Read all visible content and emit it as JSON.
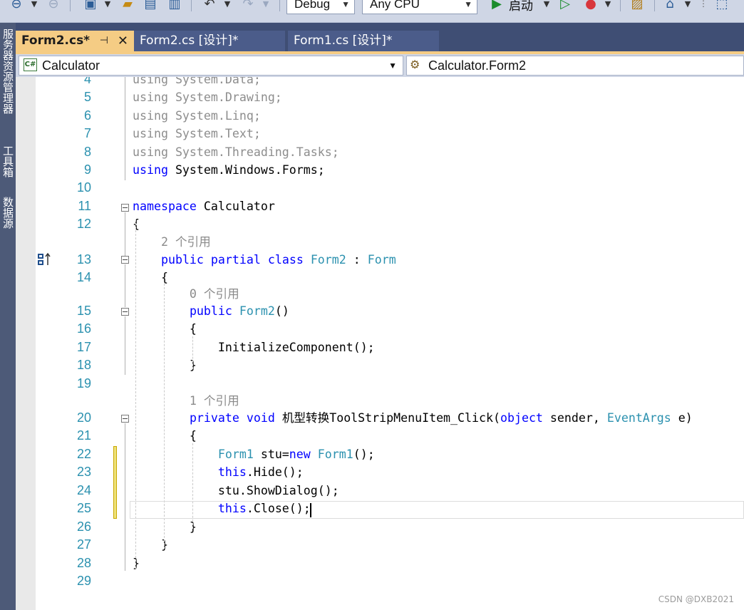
{
  "toolbar": {
    "config": "Debug",
    "platform": "Any CPU",
    "start_label": "启动"
  },
  "side_panel": {
    "tabs": [
      "服务器资源管理器",
      "工具箱",
      "数据源"
    ]
  },
  "tabs": [
    {
      "label": "Form2.cs*",
      "active": true
    },
    {
      "label": "Form2.cs [设计]*",
      "active": false
    },
    {
      "label": "Form1.cs [设计]*",
      "active": false
    }
  ],
  "navbar": {
    "project": "Calculator",
    "project_icon": "C#",
    "type": "Calculator.Form2"
  },
  "editor": {
    "lines": [
      {
        "num": "4",
        "segments": [
          {
            "t": "using System.Data;",
            "c": "fade"
          }
        ]
      },
      {
        "num": "5",
        "segments": [
          {
            "t": "using System.Drawing;",
            "c": "fade"
          }
        ]
      },
      {
        "num": "6",
        "segments": [
          {
            "t": "using System.Linq;",
            "c": "fade"
          }
        ]
      },
      {
        "num": "7",
        "segments": [
          {
            "t": "using System.Text;",
            "c": "fade"
          }
        ]
      },
      {
        "num": "8",
        "segments": [
          {
            "t": "using System.Threading.Tasks;",
            "c": "fade"
          }
        ]
      },
      {
        "num": "9",
        "segments": [
          {
            "t": "using",
            "c": "kw"
          },
          {
            "t": " System.Windows.Forms;",
            "c": ""
          }
        ]
      },
      {
        "num": "10",
        "segments": []
      },
      {
        "num": "11",
        "segments": [
          {
            "t": "namespace",
            "c": "kw"
          },
          {
            "t": " Calculator",
            "c": ""
          }
        ]
      },
      {
        "num": "12",
        "segments": [
          {
            "t": "{",
            "c": ""
          }
        ]
      },
      {
        "num": "",
        "segments": [
          {
            "t": "    2 个引用",
            "c": "ref"
          }
        ]
      },
      {
        "num": "13",
        "segments": [
          {
            "t": "    ",
            "c": ""
          },
          {
            "t": "public",
            "c": "kw"
          },
          {
            "t": " ",
            "c": ""
          },
          {
            "t": "partial",
            "c": "kw"
          },
          {
            "t": " ",
            "c": ""
          },
          {
            "t": "class",
            "c": "kw"
          },
          {
            "t": " ",
            "c": ""
          },
          {
            "t": "Form2",
            "c": "ty"
          },
          {
            "t": " : ",
            "c": ""
          },
          {
            "t": "Form",
            "c": "ty"
          }
        ]
      },
      {
        "num": "14",
        "segments": [
          {
            "t": "    {",
            "c": ""
          }
        ]
      },
      {
        "num": "",
        "segments": [
          {
            "t": "        0 个引用",
            "c": "ref"
          }
        ]
      },
      {
        "num": "15",
        "segments": [
          {
            "t": "        ",
            "c": ""
          },
          {
            "t": "public",
            "c": "kw"
          },
          {
            "t": " ",
            "c": ""
          },
          {
            "t": "Form2",
            "c": "ty"
          },
          {
            "t": "()",
            "c": ""
          }
        ]
      },
      {
        "num": "16",
        "segments": [
          {
            "t": "        {",
            "c": ""
          }
        ]
      },
      {
        "num": "17",
        "segments": [
          {
            "t": "            InitializeComponent();",
            "c": ""
          }
        ]
      },
      {
        "num": "18",
        "segments": [
          {
            "t": "        }",
            "c": ""
          }
        ]
      },
      {
        "num": "19",
        "segments": []
      },
      {
        "num": "",
        "segments": [
          {
            "t": "        1 个引用",
            "c": "ref"
          }
        ]
      },
      {
        "num": "20",
        "segments": [
          {
            "t": "        ",
            "c": ""
          },
          {
            "t": "private",
            "c": "kw"
          },
          {
            "t": " ",
            "c": ""
          },
          {
            "t": "void",
            "c": "kw"
          },
          {
            "t": " 机型转换ToolStripMenuItem_Click(",
            "c": ""
          },
          {
            "t": "object",
            "c": "kw"
          },
          {
            "t": " sender, ",
            "c": ""
          },
          {
            "t": "EventArgs",
            "c": "ty"
          },
          {
            "t": " e)",
            "c": ""
          }
        ]
      },
      {
        "num": "21",
        "segments": [
          {
            "t": "        {",
            "c": ""
          }
        ]
      },
      {
        "num": "22",
        "segments": [
          {
            "t": "            ",
            "c": ""
          },
          {
            "t": "Form1",
            "c": "ty"
          },
          {
            "t": " stu=",
            "c": ""
          },
          {
            "t": "new",
            "c": "kw"
          },
          {
            "t": " ",
            "c": ""
          },
          {
            "t": "Form1",
            "c": "ty"
          },
          {
            "t": "();",
            "c": ""
          }
        ]
      },
      {
        "num": "23",
        "segments": [
          {
            "t": "            ",
            "c": ""
          },
          {
            "t": "this",
            "c": "kw"
          },
          {
            "t": ".Hide();",
            "c": ""
          }
        ]
      },
      {
        "num": "24",
        "segments": [
          {
            "t": "            stu.ShowDialog();",
            "c": ""
          }
        ]
      },
      {
        "num": "25",
        "segments": [
          {
            "t": "            ",
            "c": ""
          },
          {
            "t": "this",
            "c": "kw"
          },
          {
            "t": ".Close();",
            "c": ""
          }
        ]
      },
      {
        "num": "26",
        "segments": [
          {
            "t": "        }",
            "c": ""
          }
        ]
      },
      {
        "num": "27",
        "segments": [
          {
            "t": "    }",
            "c": ""
          }
        ]
      },
      {
        "num": "28",
        "segments": [
          {
            "t": "}",
            "c": ""
          }
        ]
      },
      {
        "num": "29",
        "segments": []
      }
    ]
  },
  "watermark": "CSDN @DXB2021",
  "colors": {
    "keyword": "#0000ff",
    "type": "#2b91af",
    "line_number": "#2b91af",
    "tab_active": "#f5cc84",
    "tab_strip": "#3f4e74"
  }
}
